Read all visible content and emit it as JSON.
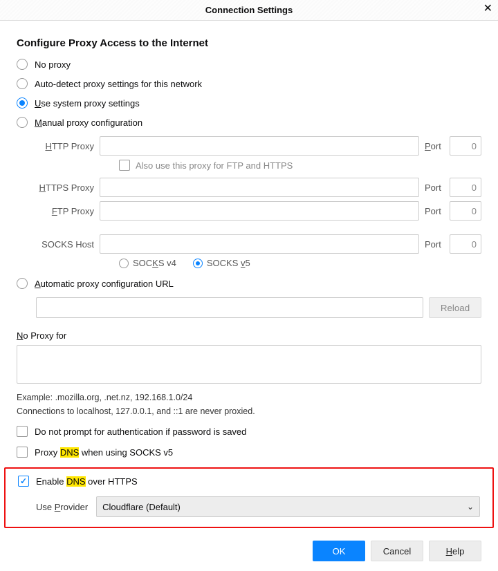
{
  "window": {
    "title": "Connection Settings"
  },
  "heading": "Configure Proxy Access to the Internet",
  "radios": {
    "no_proxy": "No proxy",
    "auto_detect": "Auto-detect proxy settings for this network",
    "system_pre": "U",
    "system_rest": "se system proxy settings",
    "manual_pre": "M",
    "manual_rest": "anual proxy configuration",
    "auto_url_pre": "A",
    "auto_url_rest": "utomatic proxy configuration URL"
  },
  "proxy": {
    "http_label_pre": "H",
    "http_label_rest": "TTP Proxy",
    "https_label_pre": "H",
    "https_label_rest": "TTPS Proxy",
    "ftp_label_pre": "F",
    "ftp_label_rest": "TP Proxy",
    "socks_label_pre": "",
    "socks_label": "SOCKS Host",
    "port_label_pre": "P",
    "port_label_rest": "ort",
    "port_value": "0",
    "also_label_pre": "A",
    "also_label_rest": "lso use this proxy for FTP and HTTPS",
    "socks4_pre": "SOC",
    "socks4_mid": "K",
    "socks4_rest": "S v4",
    "socks5_pre": "SOCKS ",
    "socks5_mid": "v",
    "socks5_rest": "5"
  },
  "pac": {
    "reload_pre": "R",
    "reload_mid": "e",
    "reload_rest": "load"
  },
  "no_proxy_section": {
    "label_pre": "N",
    "label_rest": "o Proxy for",
    "example": "Example: .mozilla.org, .net.nz, 192.168.1.0/24",
    "note": "Connections to localhost, 127.0.0.1, and ::1 are never proxied."
  },
  "checks": {
    "no_prompt": "Do not prompt for authentication if password is saved",
    "proxy_dns_pre": "Proxy ",
    "proxy_dns_hl": "DNS",
    "proxy_dns_rest": " when using SOCKS v5",
    "enable_pre": "Enable ",
    "enable_hl": "DNS",
    "enable_rest": " over HTTPS"
  },
  "provider": {
    "label_pre": "Use ",
    "label_mid": "P",
    "label_rest": "rovider",
    "value": "Cloudflare (Default)"
  },
  "buttons": {
    "ok": "OK",
    "cancel": "Cancel",
    "help_pre": "H",
    "help_rest": "elp"
  }
}
